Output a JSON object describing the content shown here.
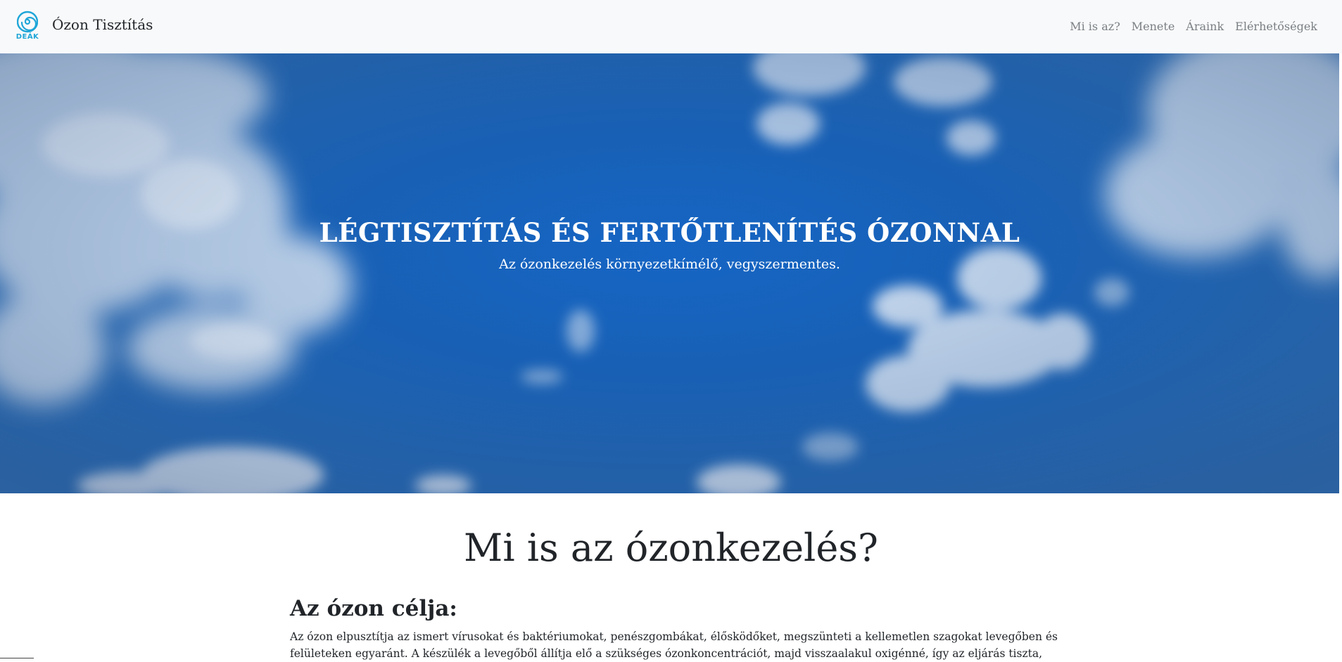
{
  "navbar": {
    "logo_text": "DEÁK",
    "brand_title": "Ózon Tisztítás",
    "links": [
      {
        "label": "Mi is az?"
      },
      {
        "label": "Menete"
      },
      {
        "label": "Áraink"
      },
      {
        "label": "Elérhetőségek"
      }
    ]
  },
  "hero": {
    "title": "LÉGTISZTÍTÁS ÉS FERTŐTLENÍTÉS ÓZONNAL",
    "subtitle": "Az ózonkezelés környezetkímélő, vegyszermentes."
  },
  "section": {
    "title": "Mi is az ózonkezelés?",
    "subheading": "Az ózon célja:",
    "paragraph": "Az ózon elpusztítja az ismert vírusokat és baktériumokat, penészgombákat, élősködőket, megszünteti a kellemetlen szagokat levegőben és felületeken egyaránt. A készülék a levegőből állítja elő a szükséges ózonkoncentrációt, majd visszaalakul oxigénné, így az eljárás tiszta,"
  },
  "colors": {
    "accent": "#1fa6d8",
    "navbar_bg": "#f8f9fa",
    "sky_blue": "#1565c4"
  }
}
